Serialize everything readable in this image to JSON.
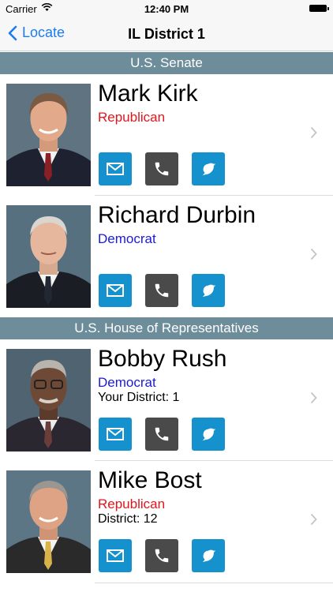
{
  "status_bar": {
    "carrier": "Carrier",
    "time": "12:40 PM"
  },
  "nav": {
    "back_label": "Locate",
    "title": "IL District 1"
  },
  "sections": [
    {
      "title": "U.S. Senate",
      "members": [
        {
          "name": "Mark Kirk",
          "party": "Republican",
          "party_color": "#e0161d"
        },
        {
          "name": "Richard Durbin",
          "party": "Democrat",
          "party_color": "#1b1bd6"
        }
      ]
    },
    {
      "title": "U.S. House of Representatives",
      "members": [
        {
          "name": "Bobby Rush",
          "party": "Democrat",
          "party_color": "#1b1bd6",
          "district": "Your District: 1"
        },
        {
          "name": "Mike Bost",
          "party": "Republican",
          "party_color": "#e0161d",
          "district": "District: 12"
        }
      ]
    }
  ],
  "colors": {
    "header_bg": "#6d8d9b",
    "accent": "#1591ce",
    "phone_bg": "#4a4a4a",
    "ios_blue": "#1b7cf5"
  },
  "icons": [
    "back-chevron-icon",
    "wifi-icon",
    "battery-icon",
    "email-icon",
    "phone-icon",
    "twitter-bird-icon",
    "chevron-right-icon"
  ]
}
